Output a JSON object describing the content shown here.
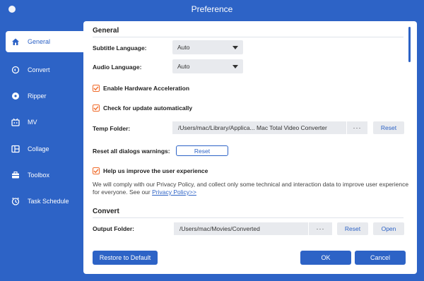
{
  "window": {
    "title": "Preference"
  },
  "sidebar": {
    "items": [
      {
        "label": "General",
        "icon": "home-icon"
      },
      {
        "label": "Convert",
        "icon": "convert-icon"
      },
      {
        "label": "Ripper",
        "icon": "disc-icon"
      },
      {
        "label": "MV",
        "icon": "mv-icon"
      },
      {
        "label": "Collage",
        "icon": "collage-icon"
      },
      {
        "label": "Toolbox",
        "icon": "toolbox-icon"
      },
      {
        "label": "Task Schedule",
        "icon": "clock-icon"
      }
    ],
    "active": "General"
  },
  "general": {
    "section_title": "General",
    "subtitle_language_label": "Subtitle Language:",
    "subtitle_language_value": "Auto",
    "audio_language_label": "Audio Language:",
    "audio_language_value": "Auto",
    "hw_accel_label": "Enable Hardware Acceleration",
    "hw_accel_checked": true,
    "update_label": "Check for update automatically",
    "update_checked": true,
    "temp_folder_label": "Temp Folder:",
    "temp_folder_value": "/Users/mac/Library/Applica... Mac Total Video Converter",
    "temp_folder_browse": "···",
    "temp_folder_reset": "Reset",
    "reset_dialogs_label": "Reset all dialogs warnings:",
    "reset_dialogs_button": "Reset",
    "improve_label": "Help us improve the user experience",
    "improve_checked": true,
    "improve_note": "We will comply with our Privacy Policy, and collect only some technical and interaction data to improve user experience for everyone. See our ",
    "privacy_link": "Privacy Policy>>"
  },
  "convert": {
    "section_title": "Convert",
    "output_folder_label": "Output Folder:",
    "output_folder_value": "/Users/mac/Movies/Converted",
    "output_browse": "···",
    "output_reset": "Reset",
    "output_open": "Open"
  },
  "footer": {
    "restore_label": "Restore to Default",
    "ok_label": "OK",
    "cancel_label": "Cancel"
  },
  "colors": {
    "accent": "#2d63c6",
    "checkbox": "#f06b2a",
    "field_bg": "#e8eaee"
  }
}
